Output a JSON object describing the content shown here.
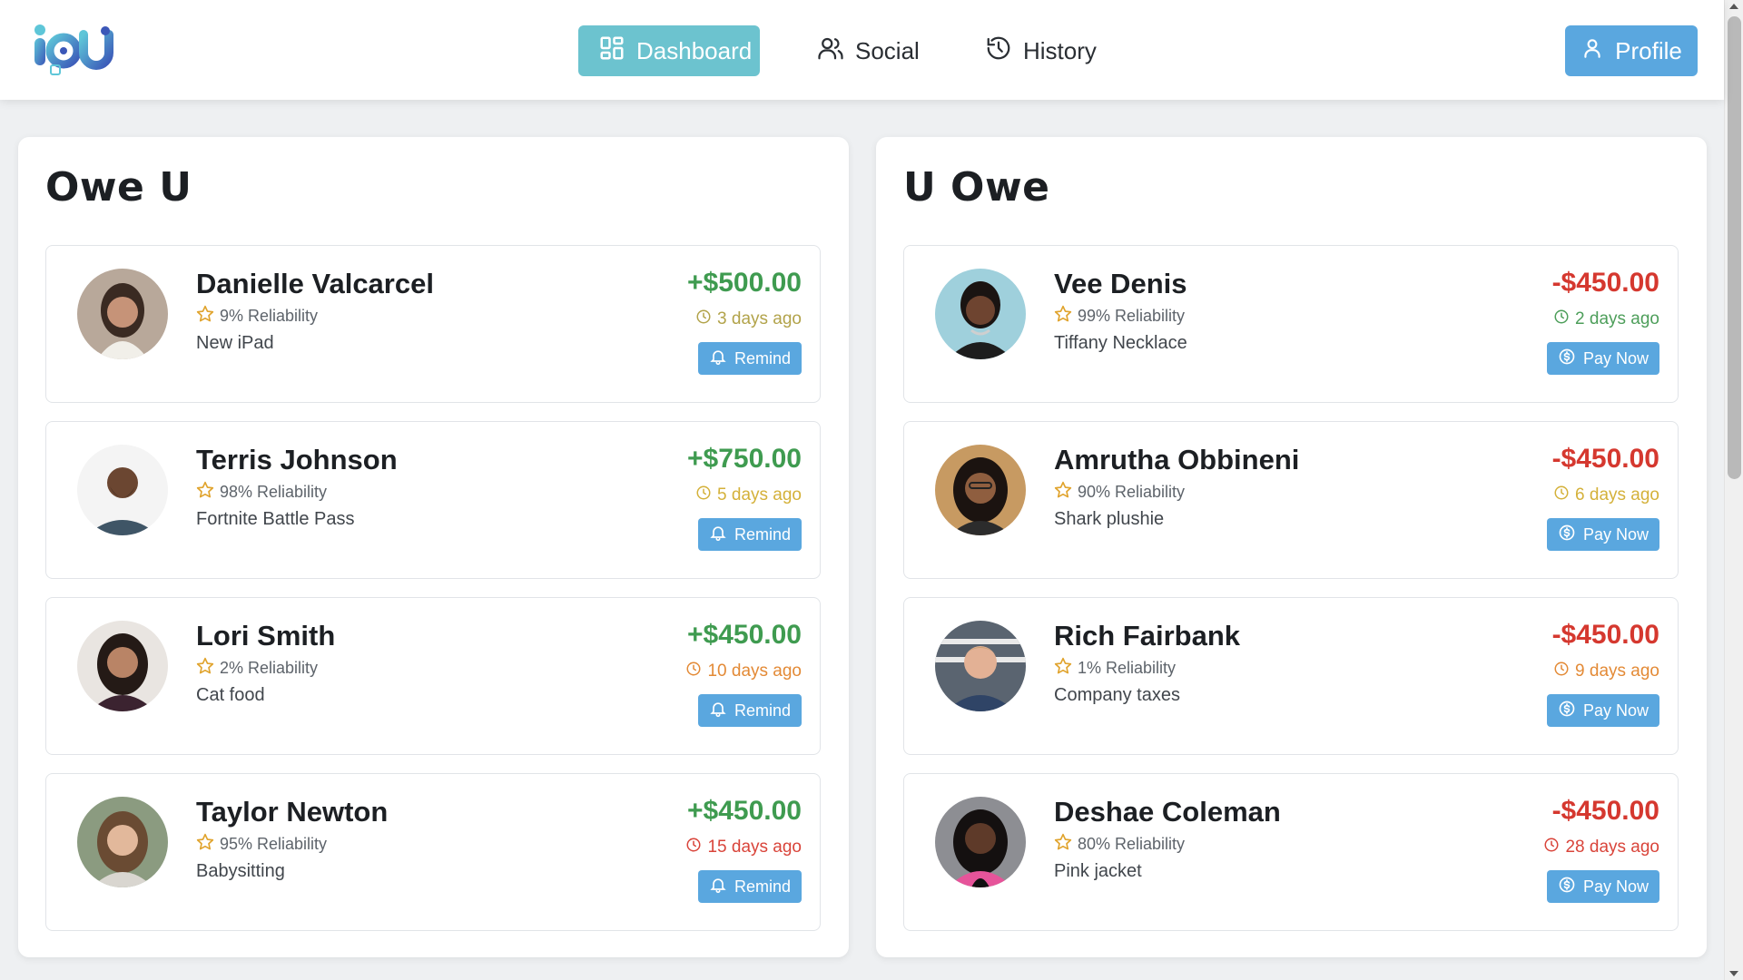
{
  "header": {
    "logo_text": "IOU",
    "nav": [
      {
        "label": "Dashboard",
        "icon": "dashboard-grid-icon",
        "active": true
      },
      {
        "label": "Social",
        "icon": "users-icon",
        "active": false
      },
      {
        "label": "History",
        "icon": "history-icon",
        "active": false
      }
    ],
    "profile_label": "Profile"
  },
  "colors": {
    "accent_active": "#6cc3cf",
    "button": "#5aa7df",
    "positive": "#3f9b50",
    "negative": "#d5382f",
    "reliability_star": "#e0a32c"
  },
  "owe_u": {
    "title": "Owe U",
    "action_label": "Remind",
    "entries": [
      {
        "name": "Danielle Valcarcel",
        "reliability": "9% Reliability",
        "item": "New iPad",
        "amount": "+$500.00",
        "when": "3 days ago",
        "when_color": "#b2a34a"
      },
      {
        "name": "Terris Johnson",
        "reliability": "98% Reliability",
        "item": "Fortnite Battle Pass",
        "amount": "+$750.00",
        "when": "5 days ago",
        "when_color": "#d4b13a"
      },
      {
        "name": "Lori Smith",
        "reliability": "2% Reliability",
        "item": "Cat food",
        "amount": "+$450.00",
        "when": "10 days ago",
        "when_color": "#e38a36"
      },
      {
        "name": "Taylor Newton",
        "reliability": "95% Reliability",
        "item": "Babysitting",
        "amount": "+$450.00",
        "when": "15 days ago",
        "when_color": "#d9443a"
      }
    ]
  },
  "u_owe": {
    "title": "U Owe",
    "action_label": "Pay Now",
    "entries": [
      {
        "name": "Vee Denis",
        "reliability": "99% Reliability",
        "item": "Tiffany Necklace",
        "amount": "-$450.00",
        "when": "2 days ago",
        "when_color": "#4d9e5a"
      },
      {
        "name": "Amrutha Obbineni",
        "reliability": "90% Reliability",
        "item": "Shark plushie",
        "amount": "-$450.00",
        "when": "6 days ago",
        "when_color": "#d4b13a"
      },
      {
        "name": "Rich Fairbank",
        "reliability": "1% Reliability",
        "item": "Company taxes",
        "amount": "-$450.00",
        "when": "9 days ago",
        "when_color": "#e38a36"
      },
      {
        "name": "Deshae Coleman",
        "reliability": "80% Reliability",
        "item": "Pink jacket",
        "amount": "-$450.00",
        "when": "28 days ago",
        "when_color": "#d9443a"
      }
    ]
  }
}
